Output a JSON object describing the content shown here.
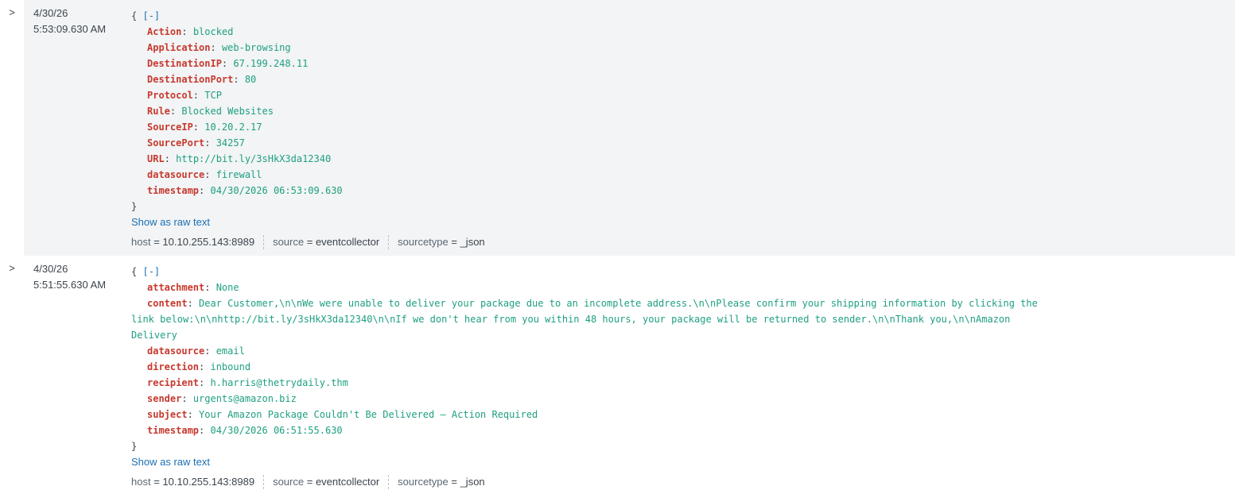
{
  "events": [
    {
      "date": "4/30/26",
      "time": "5:53:09.630 AM",
      "expander": ">",
      "open_brace": "{",
      "toggle": "[-]",
      "close_brace": "}",
      "fields": [
        {
          "key": "Action",
          "value": "blocked"
        },
        {
          "key": "Application",
          "value": "web-browsing"
        },
        {
          "key": "DestinationIP",
          "value": "67.199.248.11"
        },
        {
          "key": "DestinationPort",
          "value": "80"
        },
        {
          "key": "Protocol",
          "value": "TCP"
        },
        {
          "key": "Rule",
          "value": "Blocked Websites"
        },
        {
          "key": "SourceIP",
          "value": "10.20.2.17"
        },
        {
          "key": "SourcePort",
          "value": "34257"
        },
        {
          "key": "URL",
          "value": "http://bit.ly/3sHkX3da12340"
        },
        {
          "key": "datasource",
          "value": "firewall"
        },
        {
          "key": "timestamp",
          "value": "04/30/2026 06:53:09.630"
        }
      ],
      "raw_link": "Show as raw text",
      "meta": [
        {
          "key": "host",
          "value": "10.10.255.143:8989"
        },
        {
          "key": "source",
          "value": "eventcollector"
        },
        {
          "key": "sourcetype",
          "value": "_json"
        }
      ]
    },
    {
      "date": "4/30/26",
      "time": "5:51:55.630 AM",
      "expander": ">",
      "open_brace": "{",
      "toggle": "[-]",
      "close_brace": "}",
      "fields": [
        {
          "key": "attachment",
          "value": "None"
        },
        {
          "key": "content",
          "value": "Dear Customer,\\n\\nWe were unable to deliver your package due to an incomplete address.\\n\\nPlease confirm your shipping information by clicking the link below:\\n\\nhttp://bit.ly/3sHkX3da12340\\n\\nIf we don't hear from you within 48 hours, your package will be returned to sender.\\n\\nThank you,\\n\\nAmazon Delivery"
        },
        {
          "key": "datasource",
          "value": "email"
        },
        {
          "key": "direction",
          "value": "inbound"
        },
        {
          "key": "recipient",
          "value": "h.harris@thetrydaily.thm"
        },
        {
          "key": "sender",
          "value": "urgents@amazon.biz"
        },
        {
          "key": "subject",
          "value": "Your Amazon Package Couldn't Be Delivered – Action Required"
        },
        {
          "key": "timestamp",
          "value": "04/30/2026 06:51:55.630"
        }
      ],
      "raw_link": "Show as raw text",
      "meta": [
        {
          "key": "host",
          "value": "10.10.255.143:8989"
        },
        {
          "key": "source",
          "value": "eventcollector"
        },
        {
          "key": "sourcetype",
          "value": "_json"
        }
      ]
    }
  ]
}
